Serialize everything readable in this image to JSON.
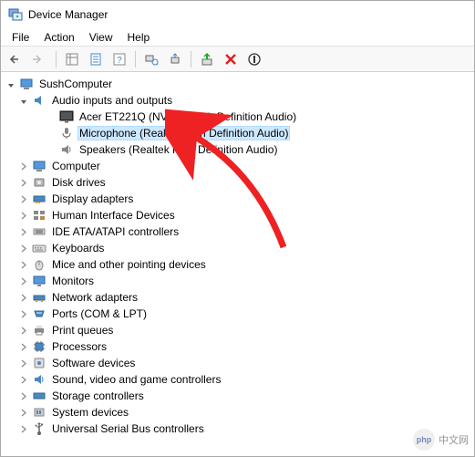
{
  "window": {
    "title": "Device Manager"
  },
  "menubar": {
    "file": "File",
    "action": "Action",
    "view": "View",
    "help": "Help"
  },
  "tree": {
    "root": "SushComputer",
    "categories": [
      {
        "key": "audio",
        "label": "Audio inputs and outputs",
        "icon": "audio",
        "expanded": true,
        "children": [
          {
            "label": "Acer ET221Q (NVIDIA High Definition Audio)",
            "icon": "monitor"
          },
          {
            "label": "Microphone (Realtek High Definition Audio)",
            "icon": "mic",
            "selected": true
          },
          {
            "label": "Speakers (Realtek High Definition Audio)",
            "icon": "speaker"
          }
        ]
      },
      {
        "key": "computer",
        "label": "Computer",
        "icon": "computer"
      },
      {
        "key": "disk",
        "label": "Disk drives",
        "icon": "disk"
      },
      {
        "key": "display",
        "label": "Display adapters",
        "icon": "display"
      },
      {
        "key": "hid",
        "label": "Human Interface Devices",
        "icon": "hid"
      },
      {
        "key": "ide",
        "label": "IDE ATA/ATAPI controllers",
        "icon": "ide"
      },
      {
        "key": "keyboards",
        "label": "Keyboards",
        "icon": "keyboard"
      },
      {
        "key": "mice",
        "label": "Mice and other pointing devices",
        "icon": "mouse"
      },
      {
        "key": "monitors",
        "label": "Monitors",
        "icon": "monitor2"
      },
      {
        "key": "network",
        "label": "Network adapters",
        "icon": "network"
      },
      {
        "key": "ports",
        "label": "Ports (COM & LPT)",
        "icon": "port"
      },
      {
        "key": "print",
        "label": "Print queues",
        "icon": "printer"
      },
      {
        "key": "processors",
        "label": "Processors",
        "icon": "cpu"
      },
      {
        "key": "software",
        "label": "Software devices",
        "icon": "software"
      },
      {
        "key": "sound",
        "label": "Sound, video and game controllers",
        "icon": "sound"
      },
      {
        "key": "storage",
        "label": "Storage controllers",
        "icon": "storage"
      },
      {
        "key": "system",
        "label": "System devices",
        "icon": "system"
      },
      {
        "key": "usb",
        "label": "Universal Serial Bus controllers",
        "icon": "usb"
      }
    ]
  },
  "watermark": "中文网"
}
